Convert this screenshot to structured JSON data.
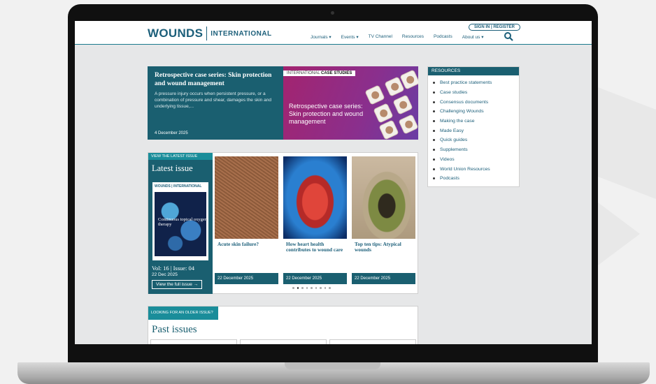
{
  "header": {
    "logo_main": "WOUNDS",
    "logo_sub": "INTERNATIONAL",
    "signin": "SIGN IN | REGISTER",
    "nav": [
      "Journals ▾",
      "Events ▾",
      "TV Channel",
      "Resources",
      "Podcasts",
      "About us ▾"
    ]
  },
  "hero": {
    "title": "Retrospective case series: Skin protection and wound management",
    "text": "A pressure injury occurs when persistent pressure, or a combination of pressure and shear, damages the skin and underlying tissue,...",
    "date": "4 December 2025",
    "tag_prefix": "INTERNATIONAL ",
    "tag_bold": "CASE STUDIES",
    "image_title": "Retrospective case series: Skin protection and wound management"
  },
  "resources": {
    "title": "RESOURCES",
    "items": [
      "Best practice statements",
      "Case studies",
      "Consensus documents",
      "Challenging Wounds",
      "Making the case",
      "Made Easy",
      "Quick guides",
      "Supplements",
      "Videos",
      "World Union Resources",
      "Podcasts"
    ]
  },
  "latest": {
    "tag": "VIEW THE LATEST ISSUE",
    "title": "Latest issue",
    "cover_logo": "WOUNDS | INTERNATIONAL",
    "cover_text": "Continuous topical oxygen therapy",
    "vol": "Vol: 16 | Issue: 04",
    "date": "22 Dec 2025",
    "button": "View the full issue →",
    "cards": [
      {
        "title": "Acute skin failure?",
        "date": "22 December 2025"
      },
      {
        "title": "How heart health contributes to wound care",
        "date": "22 December 2025"
      },
      {
        "title": "Top ten tips: Atypical wounds",
        "date": "22 December 2025"
      }
    ]
  },
  "past": {
    "tag": "LOOKING FOR AN OLDER ISSUE?",
    "title": "Past issues"
  }
}
